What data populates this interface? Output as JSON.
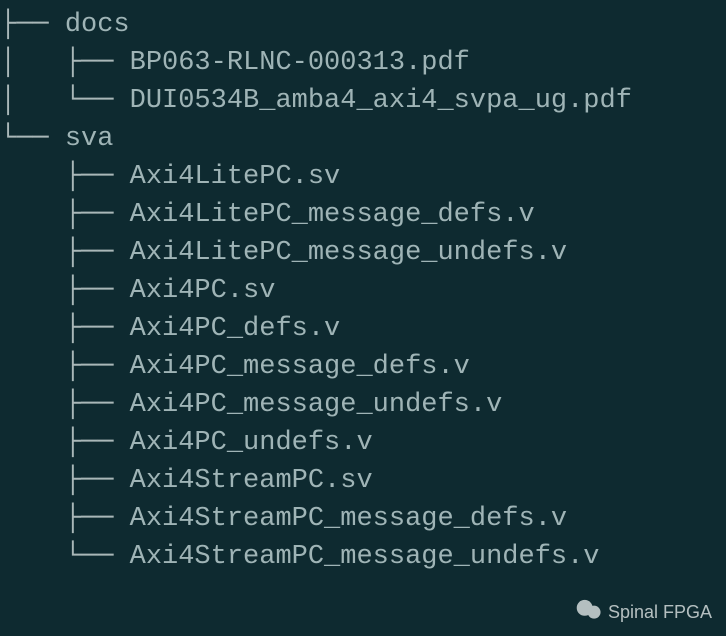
{
  "tree": {
    "dirs": [
      {
        "name": "docs",
        "branch": "├── ",
        "files": [
          {
            "branch": "│   ├── ",
            "name": "BP063-RLNC-000313.pdf"
          },
          {
            "branch": "│   └── ",
            "name": "DUI0534B_amba4_axi4_svpa_ug.pdf"
          }
        ]
      },
      {
        "name": "sva",
        "branch": "└── ",
        "files": [
          {
            "branch": "    ├── ",
            "name": "Axi4LitePC.sv"
          },
          {
            "branch": "    ├── ",
            "name": "Axi4LitePC_message_defs.v"
          },
          {
            "branch": "    ├── ",
            "name": "Axi4LitePC_message_undefs.v"
          },
          {
            "branch": "    ├── ",
            "name": "Axi4PC.sv"
          },
          {
            "branch": "    ├── ",
            "name": "Axi4PC_defs.v"
          },
          {
            "branch": "    ├── ",
            "name": "Axi4PC_message_defs.v"
          },
          {
            "branch": "    ├── ",
            "name": "Axi4PC_message_undefs.v"
          },
          {
            "branch": "    ├── ",
            "name": "Axi4PC_undefs.v"
          },
          {
            "branch": "    ├── ",
            "name": "Axi4StreamPC.sv"
          },
          {
            "branch": "    ├── ",
            "name": "Axi4StreamPC_message_defs.v"
          },
          {
            "branch": "    └── ",
            "name": "Axi4StreamPC_message_undefs.v"
          }
        ]
      }
    ]
  },
  "watermark": {
    "text": "Spinal FPGA"
  }
}
